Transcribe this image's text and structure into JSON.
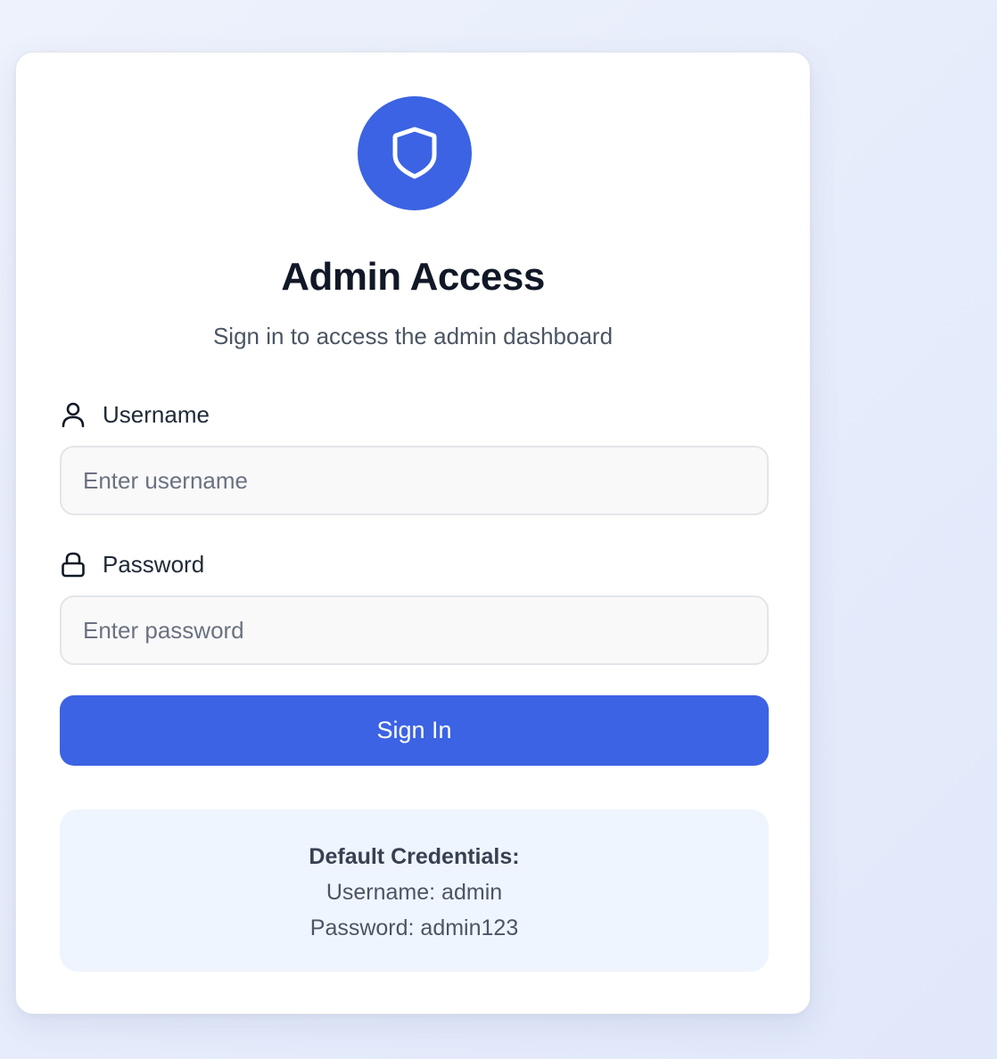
{
  "colors": {
    "accent": "#3b63e3",
    "info_box_bg": "#eff5fe"
  },
  "header": {
    "logo_icon": "shield-icon",
    "title": "Admin Access",
    "subtitle": "Sign in to access the admin dashboard"
  },
  "form": {
    "username": {
      "icon": "user-icon",
      "label": "Username",
      "placeholder": "Enter username",
      "value": ""
    },
    "password": {
      "icon": "lock-icon",
      "label": "Password",
      "placeholder": "Enter password",
      "value": ""
    },
    "submit_label": "Sign In"
  },
  "credentials": {
    "title": "Default Credentials:",
    "username_line": "Username: admin",
    "password_line": "Password: admin123"
  }
}
